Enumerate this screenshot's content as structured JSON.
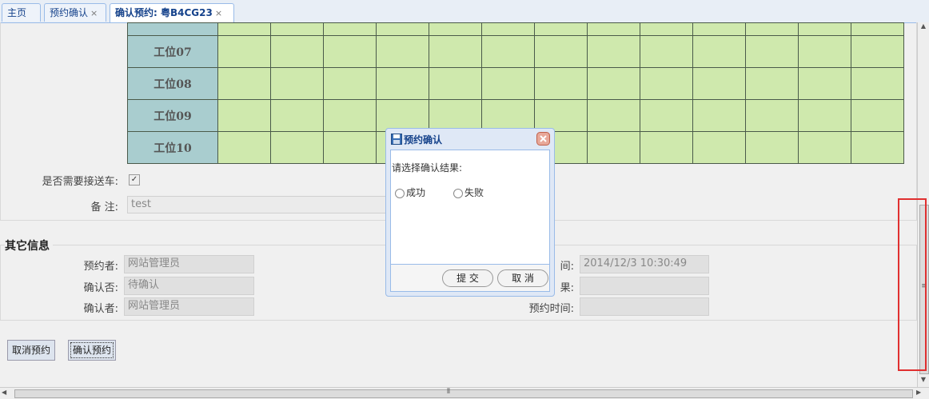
{
  "tabs": [
    {
      "label": "主页"
    },
    {
      "label": "预约确认",
      "close": "×"
    },
    {
      "label": "确认预约: 粤B4CG23",
      "close": "×"
    }
  ],
  "grid": {
    "rows": [
      "工位07",
      "工位08",
      "工位09",
      "工位10"
    ]
  },
  "form": {
    "pickup_label": "是否需要接送车:",
    "pickup_checked": "✓",
    "remark_label": "备 注:",
    "remark_value": "test"
  },
  "other": {
    "title": "其它信息",
    "booker_label": "预约者:",
    "booker_value": "网站管理员",
    "confirmed_label": "确认否:",
    "confirmed_value": "待确认",
    "confirmer_label": "确认者:",
    "confirmer_value": "网站管理员",
    "right1_label": "间:",
    "right1_value": "2014/12/3 10:30:49",
    "right2_label": "果:",
    "right2_value": "",
    "right3_label": "预约时间:",
    "right3_value": ""
  },
  "actions": {
    "cancel_booking": "取消预约",
    "confirm_booking": "确认预约"
  },
  "dialog": {
    "title": "预约确认",
    "prompt": "请选择确认结果:",
    "option_success": "成功",
    "option_fail": "失败",
    "submit": "提 交",
    "cancel": "取 消"
  },
  "scrollbar_grip": "≡",
  "hscroll_grip": "⦀"
}
